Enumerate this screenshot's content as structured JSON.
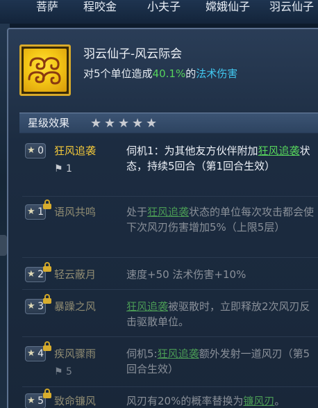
{
  "top_names": [
    "菩萨",
    "程咬金",
    "小夫子",
    "嫦娥仙子",
    "羽云仙子"
  ],
  "skill": {
    "icon": "cloud-swirl-icon",
    "title": "羽云仙子-风云际会",
    "desc_prefix": "对5个单位造成",
    "desc_value": "40.1%",
    "desc_mid": "的",
    "desc_link": "法术伤害"
  },
  "section": {
    "title": "星级效果",
    "stars_count": 5
  },
  "effects": [
    {
      "star": "0",
      "name": "狂风追袭",
      "flag": "1",
      "locked": false,
      "t1": "伺机1：为其他友方伙伴附加",
      "link": "狂风追袭",
      "t2": "状态，持续5回合（第1回合生效）"
    },
    {
      "star": "1",
      "name": "语风共鸣",
      "locked": true,
      "t1": "处于",
      "link": "狂风追袭",
      "t2": "状态的单位每次攻击都会使下次风刃伤害增加5%（上限5层）"
    },
    {
      "star": "2",
      "name": "轻云蔽月",
      "locked": true,
      "t1": "速度+50 法术伤害+10%",
      "link": "",
      "t2": ""
    },
    {
      "star": "3",
      "name": "暴躁之风",
      "locked": true,
      "t1": "",
      "link": "狂风追袭",
      "t2": "被驱散时，立即释放2次风刃反击驱散单位。"
    },
    {
      "star": "4",
      "name": "疾风骤雨",
      "flag": "5",
      "locked": true,
      "t1": "伺机5:",
      "link": "狂风追袭",
      "t2": "额外发射一道风刃（第5回合生效）"
    },
    {
      "star": "5",
      "name": "致命镰风",
      "locked": true,
      "t1": "风刃有20%的概率替换为",
      "link": "镰风刃",
      "t2": "。"
    }
  ],
  "colors": {
    "accent_green": "#56d35c",
    "accent_cyan": "#41c8f0",
    "gold": "#f2c83a"
  }
}
